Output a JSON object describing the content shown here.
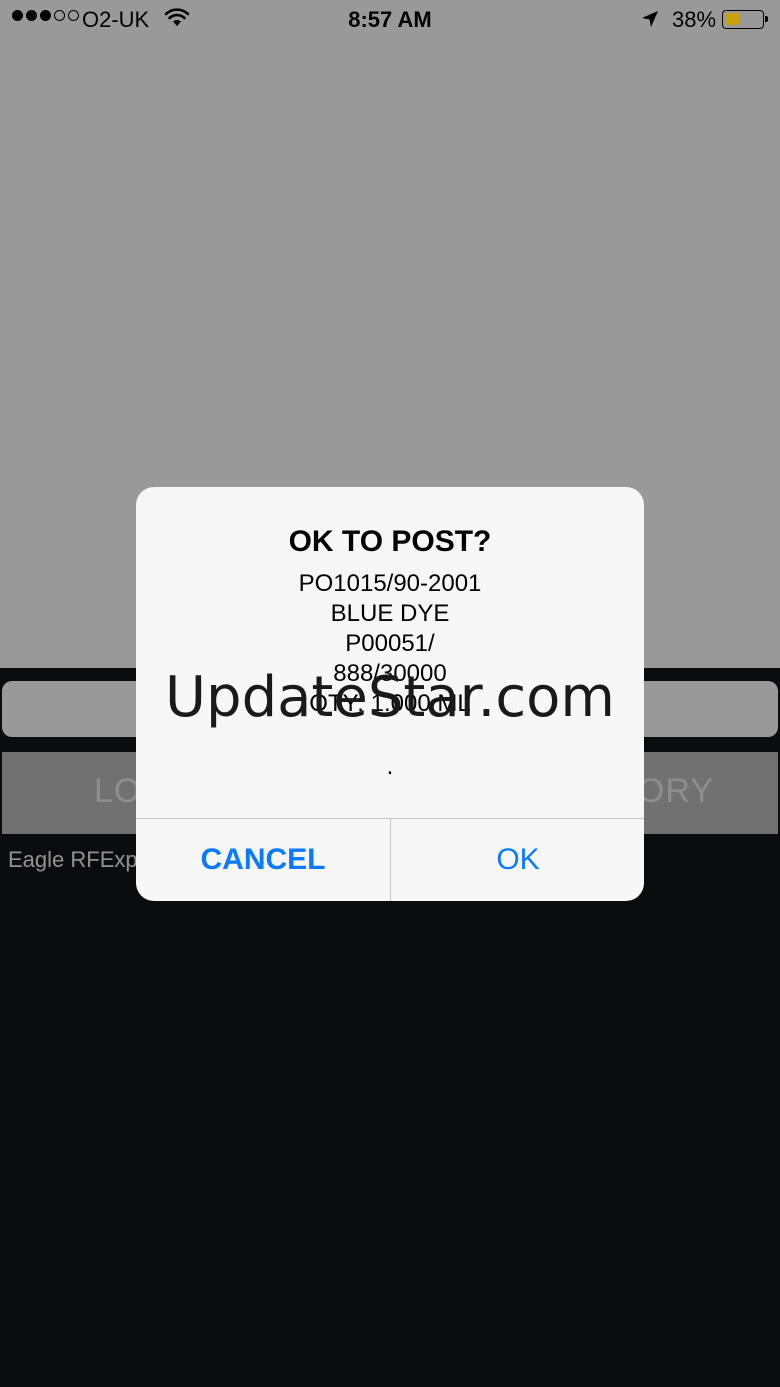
{
  "status_bar": {
    "carrier": "O2-UK",
    "time": "8:57 AM",
    "battery_percent": "38%",
    "battery_level": 0.38,
    "signal_bars_filled": 3,
    "signal_bars_total": 5,
    "battery_color": "#c9a20a"
  },
  "app": {
    "button_left_partial": "LO",
    "button_right_partial": "ORY",
    "footer_partial": "Eagle RFExp"
  },
  "alert": {
    "title": "OK TO POST?",
    "lines": [
      "PO1015/90-2001",
      "BLUE DYE",
      "P00051/",
      "888/30000",
      "QTY: 1.000 ML"
    ],
    "dot": ".",
    "cancel_label": "CANCEL",
    "ok_label": "OK",
    "button_color": "#0a7aff"
  },
  "watermark": "UpdateStar.com"
}
